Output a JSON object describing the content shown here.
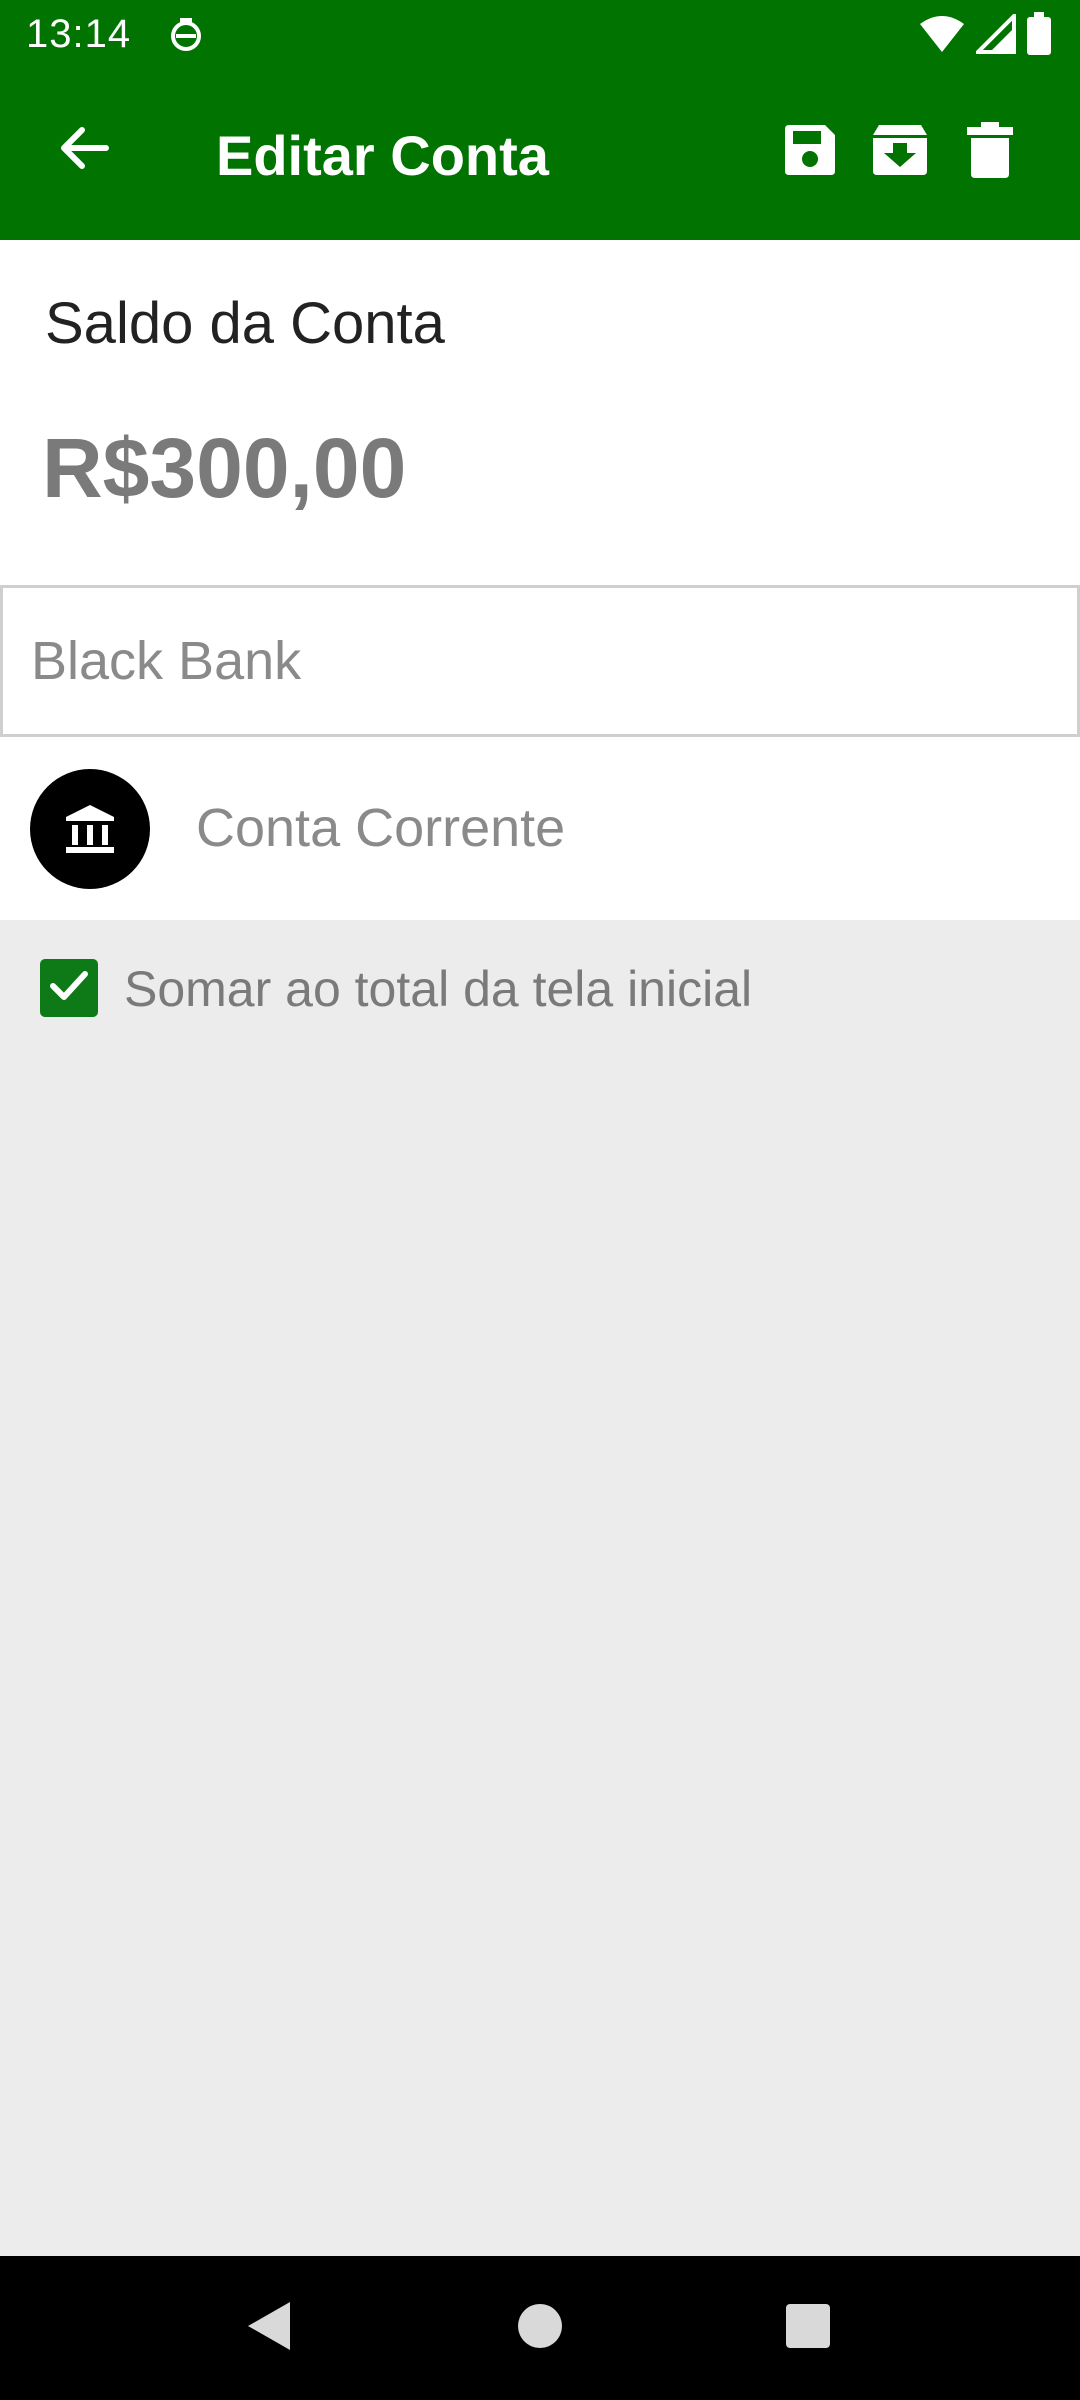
{
  "status_bar": {
    "time": "13:14",
    "icons": [
      "notification-icon",
      "wifi-icon",
      "signal-icon",
      "battery-icon"
    ]
  },
  "app_bar": {
    "title": "Editar Conta",
    "actions": [
      "save-icon",
      "archive-icon",
      "delete-icon"
    ],
    "color": "#007300"
  },
  "account": {
    "balance_label": "Saldo da Conta",
    "balance_value": "R$300,00",
    "name_placeholder": "Black Bank",
    "type_label": "Conta Corrente",
    "type_icon": "bank-icon"
  },
  "options": {
    "sum_to_total_label": "Somar ao total da tela inicial",
    "sum_to_total_checked": true
  },
  "nav_bar": {
    "buttons": [
      "back-triangle",
      "home-circle",
      "recents-square"
    ]
  }
}
